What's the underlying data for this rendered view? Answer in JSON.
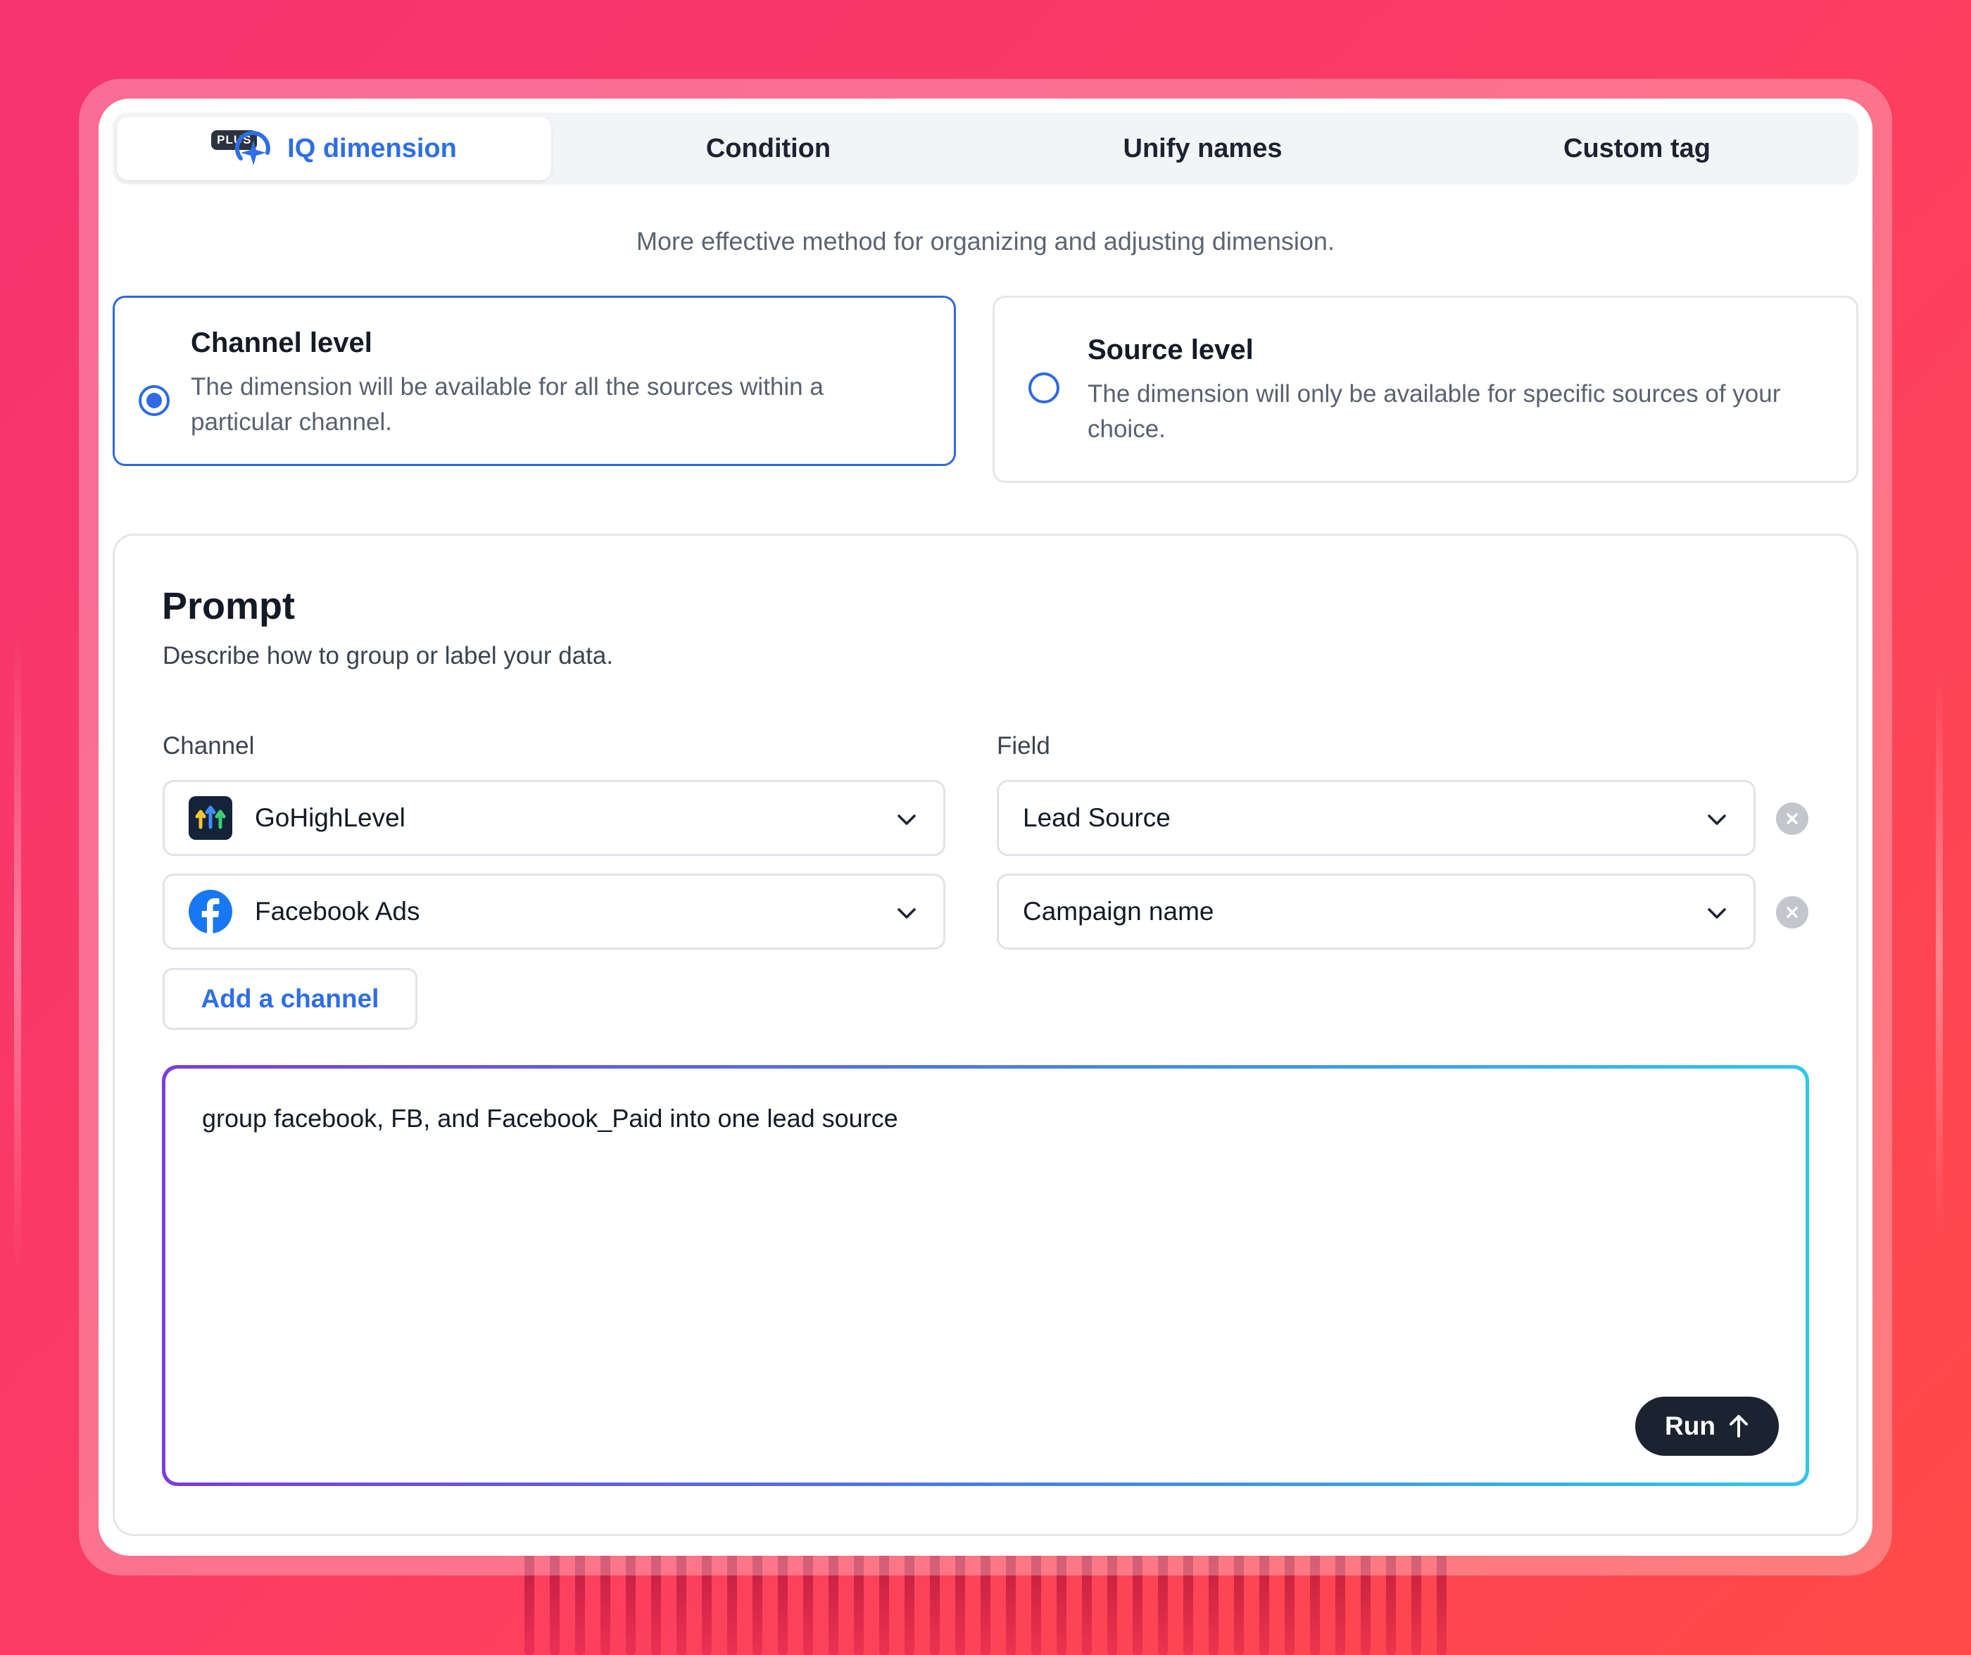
{
  "tabs": [
    {
      "label": "IQ dimension",
      "badge": "PLUS",
      "active": true
    },
    {
      "label": "Condition",
      "active": false
    },
    {
      "label": "Unify names",
      "active": false
    },
    {
      "label": "Custom tag",
      "active": false
    }
  ],
  "subtitle": "More effective method for organizing and adjusting dimension.",
  "levels": {
    "channel": {
      "title": "Channel level",
      "description": "The dimension will be available for all the sources within a particular channel.",
      "selected": true
    },
    "source": {
      "title": "Source level",
      "description": "The dimension will only be available for specific sources of your choice.",
      "selected": false
    }
  },
  "prompt": {
    "title": "Prompt",
    "subtitle": "Describe how to group or label your data.",
    "channel_label": "Channel",
    "field_label": "Field",
    "rows": [
      {
        "channel": "GoHighLevel",
        "channel_icon": "gohighlevel-icon",
        "field": "Lead Source"
      },
      {
        "channel": "Facebook Ads",
        "channel_icon": "facebook-icon",
        "field": "Campaign name"
      }
    ],
    "add_channel_label": "Add a channel",
    "input_text": "group facebook, FB, and Facebook_Paid into one lead source",
    "run_label": "Run"
  },
  "colors": {
    "accent": "#2e6ee6",
    "run_button": "#1b2330",
    "gradient_start": "#7a3de0",
    "gradient_end": "#2fc7ea"
  }
}
